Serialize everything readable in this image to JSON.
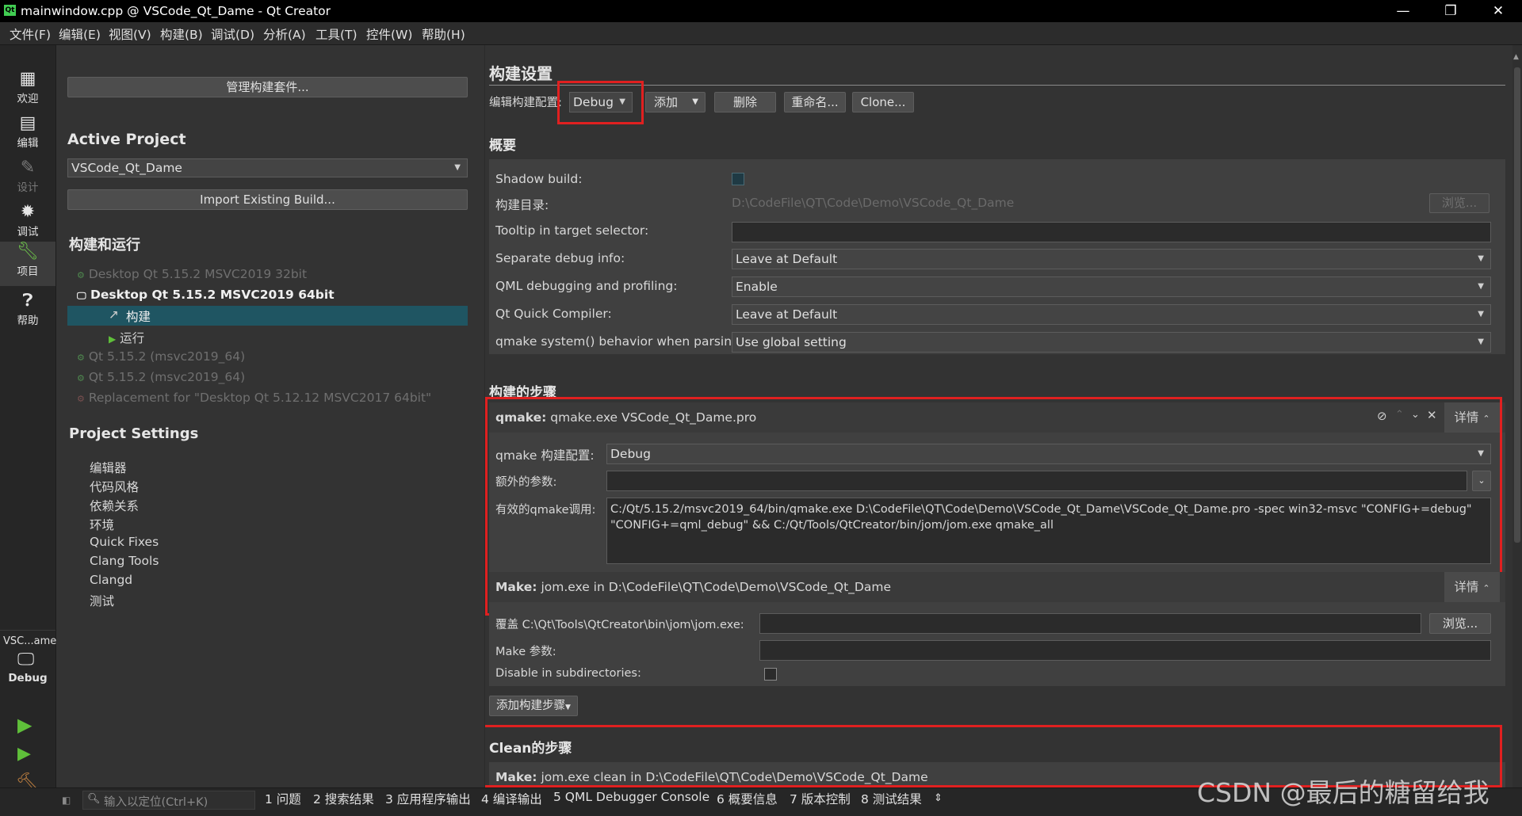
{
  "window": {
    "title": "mainwindow.cpp @ VSCode_Qt_Dame - Qt Creator",
    "app_icon": "Qt",
    "minimize": "—",
    "restore": "❐",
    "close": "✕"
  },
  "menu": [
    "文件(F)",
    "编辑(E)",
    "视图(V)",
    "构建(B)",
    "调试(D)",
    "分析(A)",
    "工具(T)",
    "控件(W)",
    "帮助(H)"
  ],
  "modes": [
    {
      "label": "欢迎",
      "icon": "grid-icon"
    },
    {
      "label": "编辑",
      "icon": "document-icon"
    },
    {
      "label": "设计",
      "icon": "pencil-icon"
    },
    {
      "label": "调试",
      "icon": "bug-icon"
    },
    {
      "label": "项目",
      "icon": "wrench-icon"
    },
    {
      "label": "帮助",
      "icon": "help-icon"
    }
  ],
  "kit_selector": {
    "project": "VSC...ame",
    "build": "Debug"
  },
  "left": {
    "manage_kits": "管理构建套件...",
    "active_project_title": "Active Project",
    "active_project_value": "VSCode_Qt_Dame",
    "import_build": "Import Existing Build...",
    "build_run_title": "构建和运行",
    "kits": [
      {
        "label": "Desktop Qt 5.15.2 MSVC2019 32bit",
        "state": "dim"
      },
      {
        "label": "Desktop Qt 5.15.2 MSVC2019 64bit",
        "state": "active"
      },
      {
        "label": "构建",
        "state": "selected"
      },
      {
        "label": "运行",
        "state": "child"
      },
      {
        "label": "Qt 5.15.2 (msvc2019_64)",
        "state": "dim"
      },
      {
        "label": "Qt 5.15.2 (msvc2019_64)",
        "state": "dim"
      },
      {
        "label": "Replacement for \"Desktop Qt 5.12.12 MSVC2017 64bit\"",
        "state": "dim"
      }
    ],
    "project_settings_title": "Project Settings",
    "settings": [
      "编辑器",
      "代码风格",
      "依赖关系",
      "环境",
      "Quick Fixes",
      "Clang Tools",
      "Clangd",
      "测试"
    ]
  },
  "build_settings": {
    "title": "构建设置",
    "edit_config_label": "编辑构建配置:",
    "config_value": "Debug",
    "add": "添加",
    "remove": "删除",
    "rename": "重命名...",
    "clone": "Clone..."
  },
  "general": {
    "title": "概要",
    "shadow_build": "Shadow build:",
    "build_dir_label": "构建目录:",
    "build_dir_value": "D:\\CodeFile\\QT\\Code\\Demo\\VSCode_Qt_Dame",
    "browse": "浏览...",
    "tooltip_label": "Tooltip in target selector:",
    "sep_debug_label": "Separate debug info:",
    "sep_debug_value": "Leave at Default",
    "qml_debug_label": "QML debugging and profiling:",
    "qml_debug_value": "Enable",
    "quick_compiler_label": "Qt Quick Compiler:",
    "quick_compiler_value": "Leave at Default",
    "qmake_system_label": "qmake system() behavior when parsing:",
    "qmake_system_value": "Use global setting"
  },
  "build_steps": {
    "title": "构建的步骤",
    "qmake_step_bold": "qmake:",
    "qmake_step_text": "qmake.exe VSCode_Qt_Dame.pro",
    "details": "详情",
    "qmake_config_label": "qmake 构建配置:",
    "qmake_config_value": "Debug",
    "extra_args_label": "额外的参数:",
    "effective_label": "有效的qmake调用:",
    "effective_line1": "C:/Qt/5.15.2/msvc2019_64/bin/qmake.exe D:\\CodeFile\\QT\\Code\\Demo\\VSCode_Qt_Dame\\VSCode_Qt_Dame.pro -spec win32-msvc \"CONFIG+=debug\"",
    "effective_line2": "\"CONFIG+=qml_debug\" && C:/Qt/Tools/QtCreator/bin/jom/jom.exe qmake_all",
    "make_step_bold": "Make:",
    "make_step_text": "jom.exe in D:\\CodeFile\\QT\\Code\\Demo\\VSCode_Qt_Dame",
    "override_label": "覆盖 C:\\Qt\\Tools\\QtCreator\\bin\\jom\\jom.exe:",
    "make_args_label": "Make 参数:",
    "disable_sub_label": "Disable in subdirectories:",
    "add_step": "添加构建步骤"
  },
  "clean_steps": {
    "title": "Clean的步骤",
    "make_step_bold": "Make:",
    "make_step_text": "jom.exe clean in D:\\CodeFile\\QT\\Code\\Demo\\VSCode_Qt_Dame"
  },
  "statusbar": {
    "locator_placeholder": "输入以定位(Ctrl+K)",
    "tabs": [
      "1 问题",
      "2 搜索结果",
      "3 应用程序输出",
      "4 编译输出",
      "5 QML Debugger Console",
      "6 概要信息",
      "7 版本控制",
      "8 测试结果"
    ]
  },
  "watermark": "CSDN @最后的糖留给我",
  "colors": {
    "accent_selected": "#1f5562",
    "annotation_red": "#e02020",
    "qt_green": "#41cd52"
  }
}
